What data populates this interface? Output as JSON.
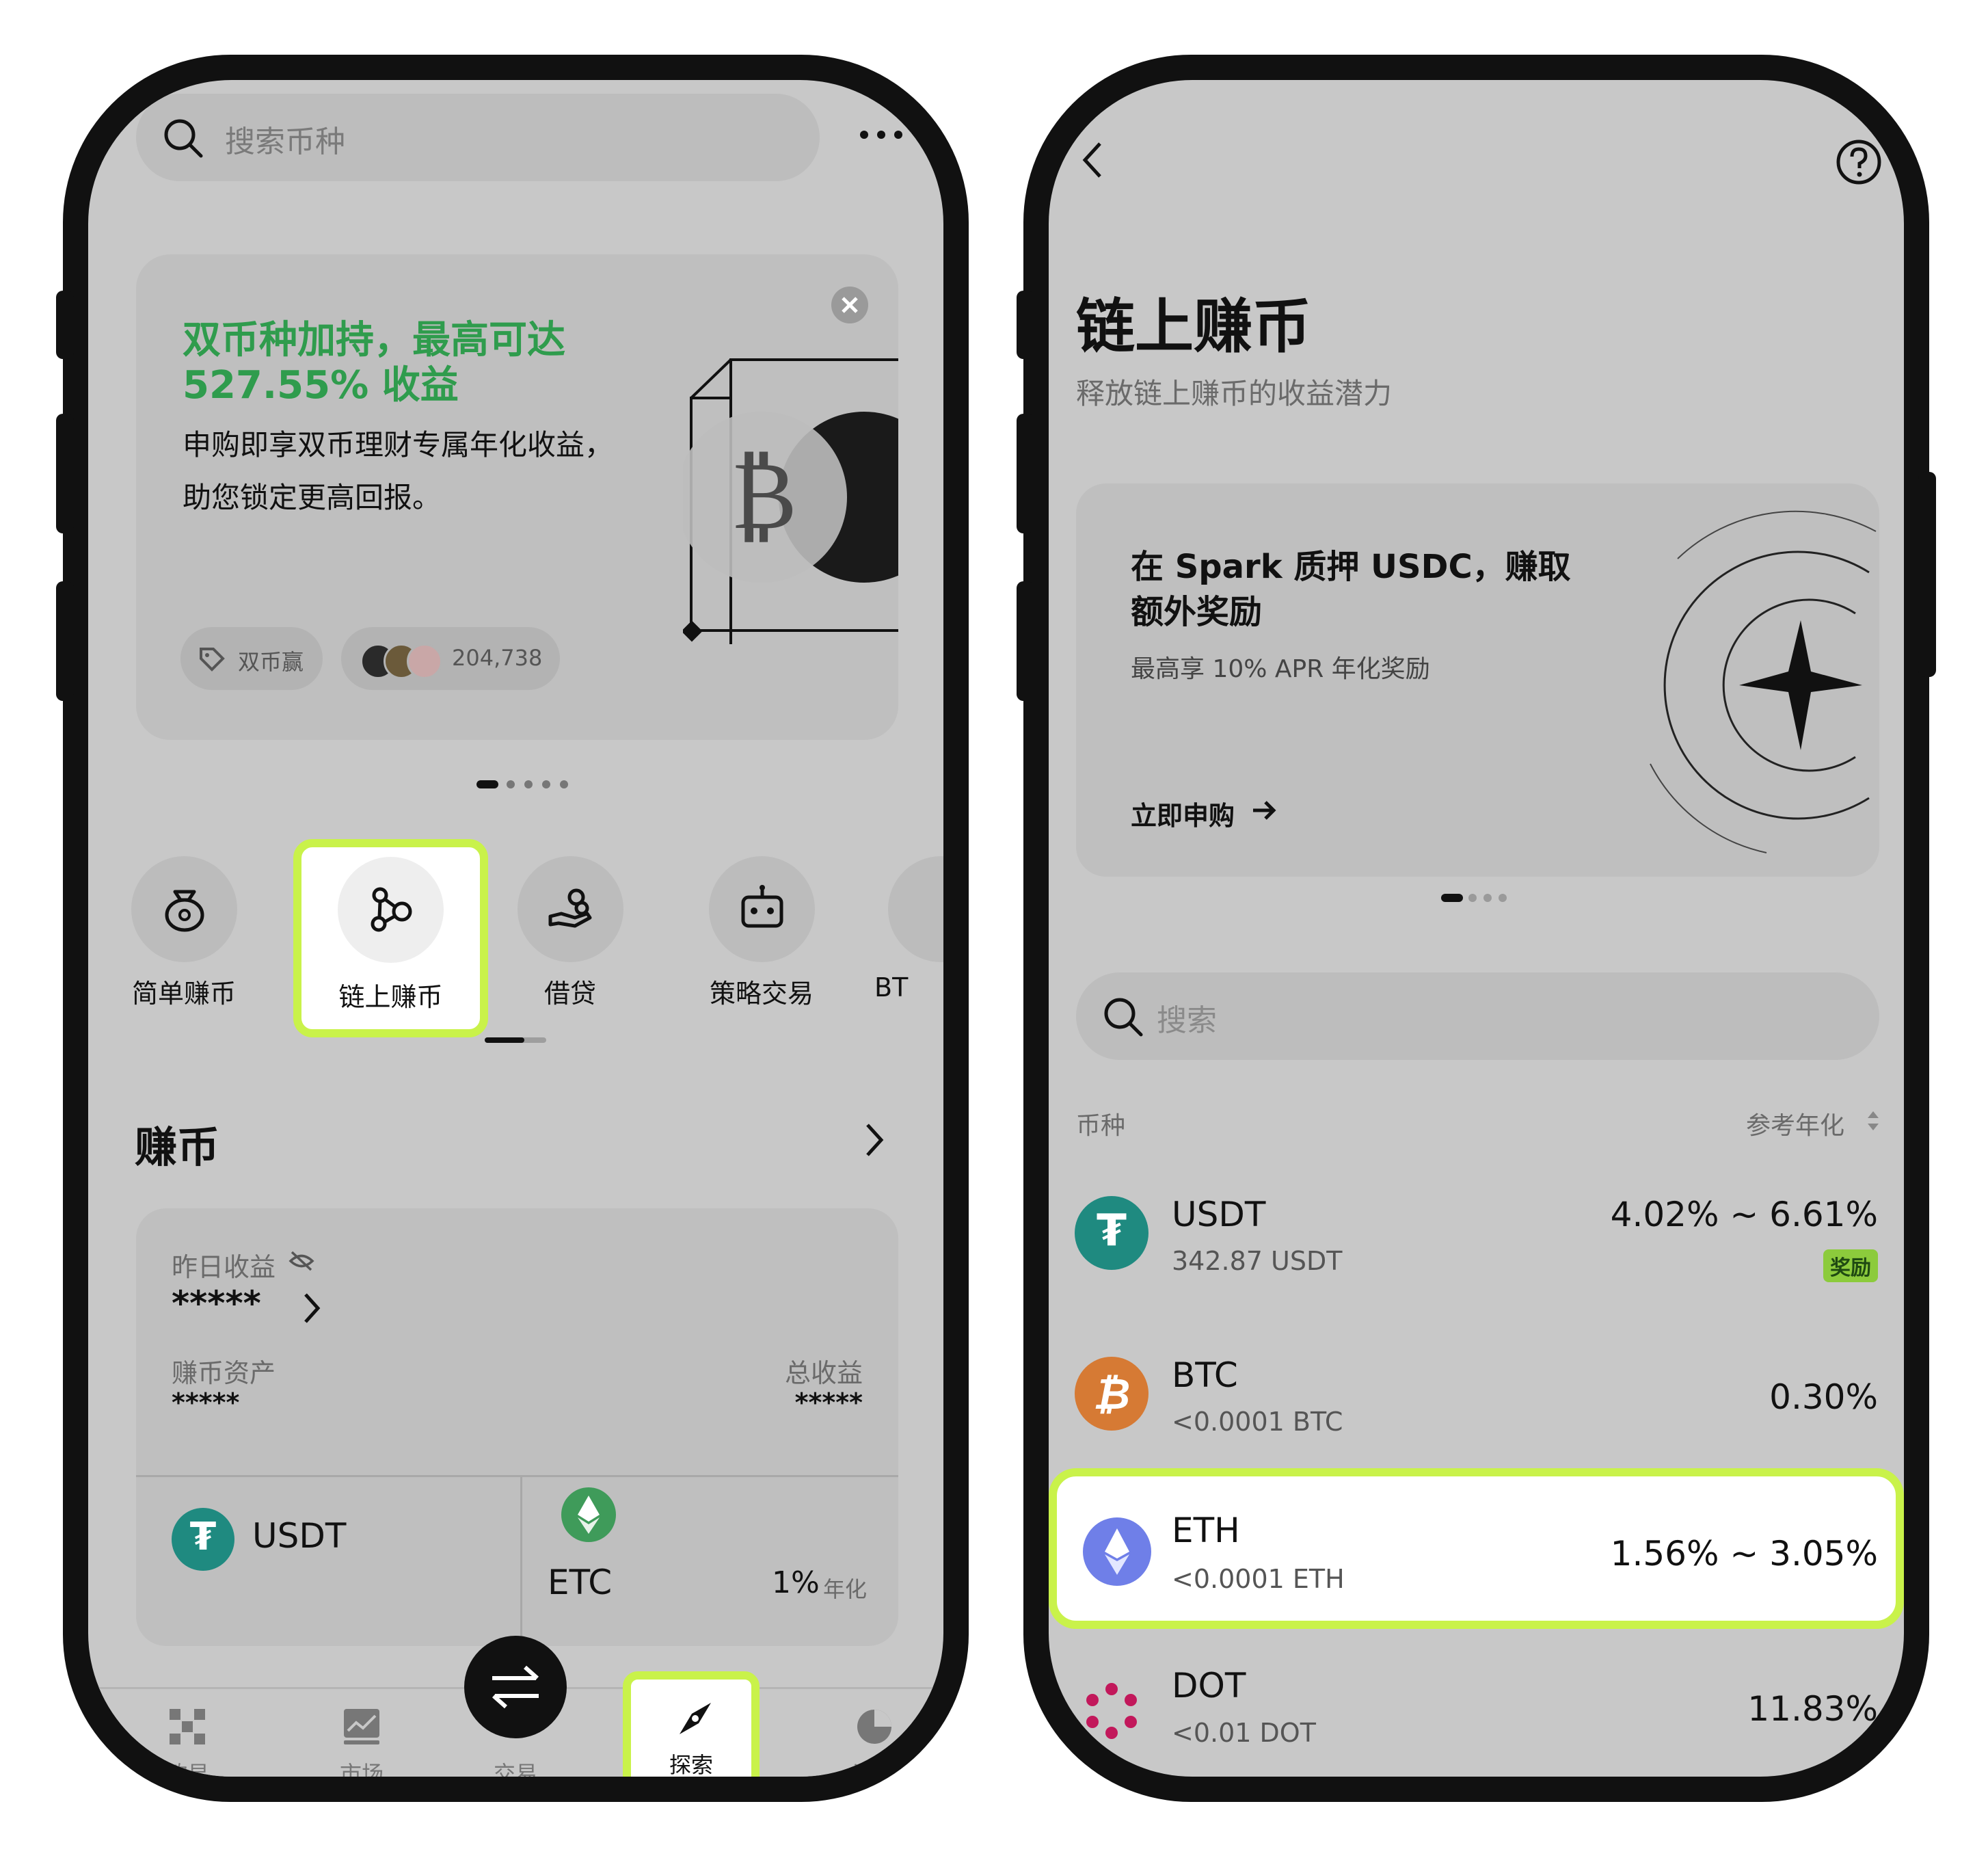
{
  "left": {
    "search_placeholder": "搜索币种",
    "banner": {
      "headline_1": "双币种加持，最高可达",
      "headline_2": "527.55% 收益",
      "body_1": "申购即享双币理财专属年化收益，",
      "body_2": "助您锁定更高回报。",
      "chip_label": "双币赢",
      "participants": "204,738"
    },
    "features": [
      {
        "label": "简单赚币"
      },
      {
        "label": "链上赚币"
      },
      {
        "label": "借贷"
      },
      {
        "label": "策略交易"
      },
      {
        "label": "BT"
      }
    ],
    "earn": {
      "title": "赚币",
      "yesterday_label": "昨日收益",
      "yesterday_value": "*****",
      "assets_label": "赚币资产",
      "assets_value": "*****",
      "total_label": "总收益",
      "total_value": "*****",
      "coin_1": "USDT",
      "coin_2": "ETC",
      "coin_2_rate": "1%",
      "coin_2_rate_unit": "年化"
    },
    "nav": [
      {
        "label": "欧易"
      },
      {
        "label": "市场"
      },
      {
        "label": "交易"
      },
      {
        "label": "探索"
      },
      {
        "label": "资产"
      }
    ]
  },
  "right": {
    "title": "链上赚币",
    "subtitle": "释放链上赚币的收益潜力",
    "promo": {
      "title_1": "在 Spark 质押 USDC，赚取",
      "title_2": "额外奖励",
      "desc": "最高享 10% APR 年化奖励",
      "cta": "立即申购"
    },
    "search_placeholder": "搜索",
    "col_coin": "币种",
    "col_apr": "参考年化",
    "rows": [
      {
        "symbol": "USDT",
        "amount": "342.87 USDT",
        "apr": "4.02% ~ 6.61%",
        "badge": "奖励"
      },
      {
        "symbol": "BTC",
        "amount": "<0.0001 BTC",
        "apr": "0.30%"
      },
      {
        "symbol": "ETH",
        "amount": "<0.0001 ETH",
        "apr": "1.56% ~ 3.05%"
      },
      {
        "symbol": "DOT",
        "amount": "<0.01 DOT",
        "apr": "11.83%"
      }
    ]
  },
  "colors": {
    "accent_green": "#2f9c4d",
    "highlight": "#c9f24a",
    "usdt": "#1f8a80",
    "btc": "#d67a34",
    "eth": "#6f7fe8",
    "dot": "#c2185b"
  }
}
